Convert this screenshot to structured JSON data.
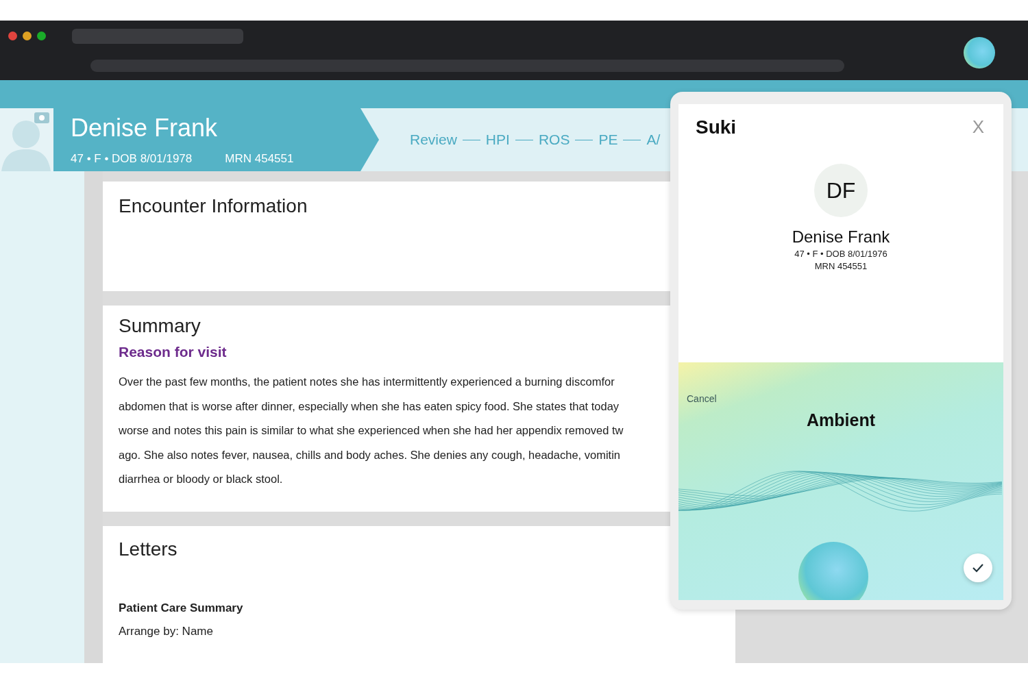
{
  "patient": {
    "name": "Denise Frank",
    "details": "47 • F • DOB 8/01/1978",
    "mrn": "MRN 454551"
  },
  "steps": [
    {
      "label": "Review"
    },
    {
      "label": "HPI"
    },
    {
      "label": "ROS"
    },
    {
      "label": "PE"
    },
    {
      "label": "A/"
    }
  ],
  "sections": [
    {
      "kind": "info",
      "title": "Encounter Information"
    },
    {
      "kind": "summary",
      "title": "Summary",
      "subtitle": "Reason for visit",
      "lines": [
        "Over the past few months, the patient notes she has intermittently experienced a burning discomfor",
        "abdomen that is worse after dinner, especially when she has eaten spicy food. She states  that today",
        "worse and notes this pain is similar to what she experienced when she had her appendix removed tw",
        "ago.  She also notes fever, nausea, chills and body aches. She denies any cough, headache, vomitin",
        "diarrhea or bloody or black stool."
      ]
    },
    {
      "kind": "letters",
      "title": "Letters",
      "heading": "Patient Care Summary",
      "arrange": "Arrange by: Name"
    }
  ],
  "suki": {
    "brand": "Suki",
    "close": "X",
    "initials": "DF",
    "name": "Denise Frank",
    "details": "47 • F • DOB 8/01/1976",
    "mrn": "MRN 454551",
    "cancel": "Cancel",
    "mode": "Ambient"
  }
}
